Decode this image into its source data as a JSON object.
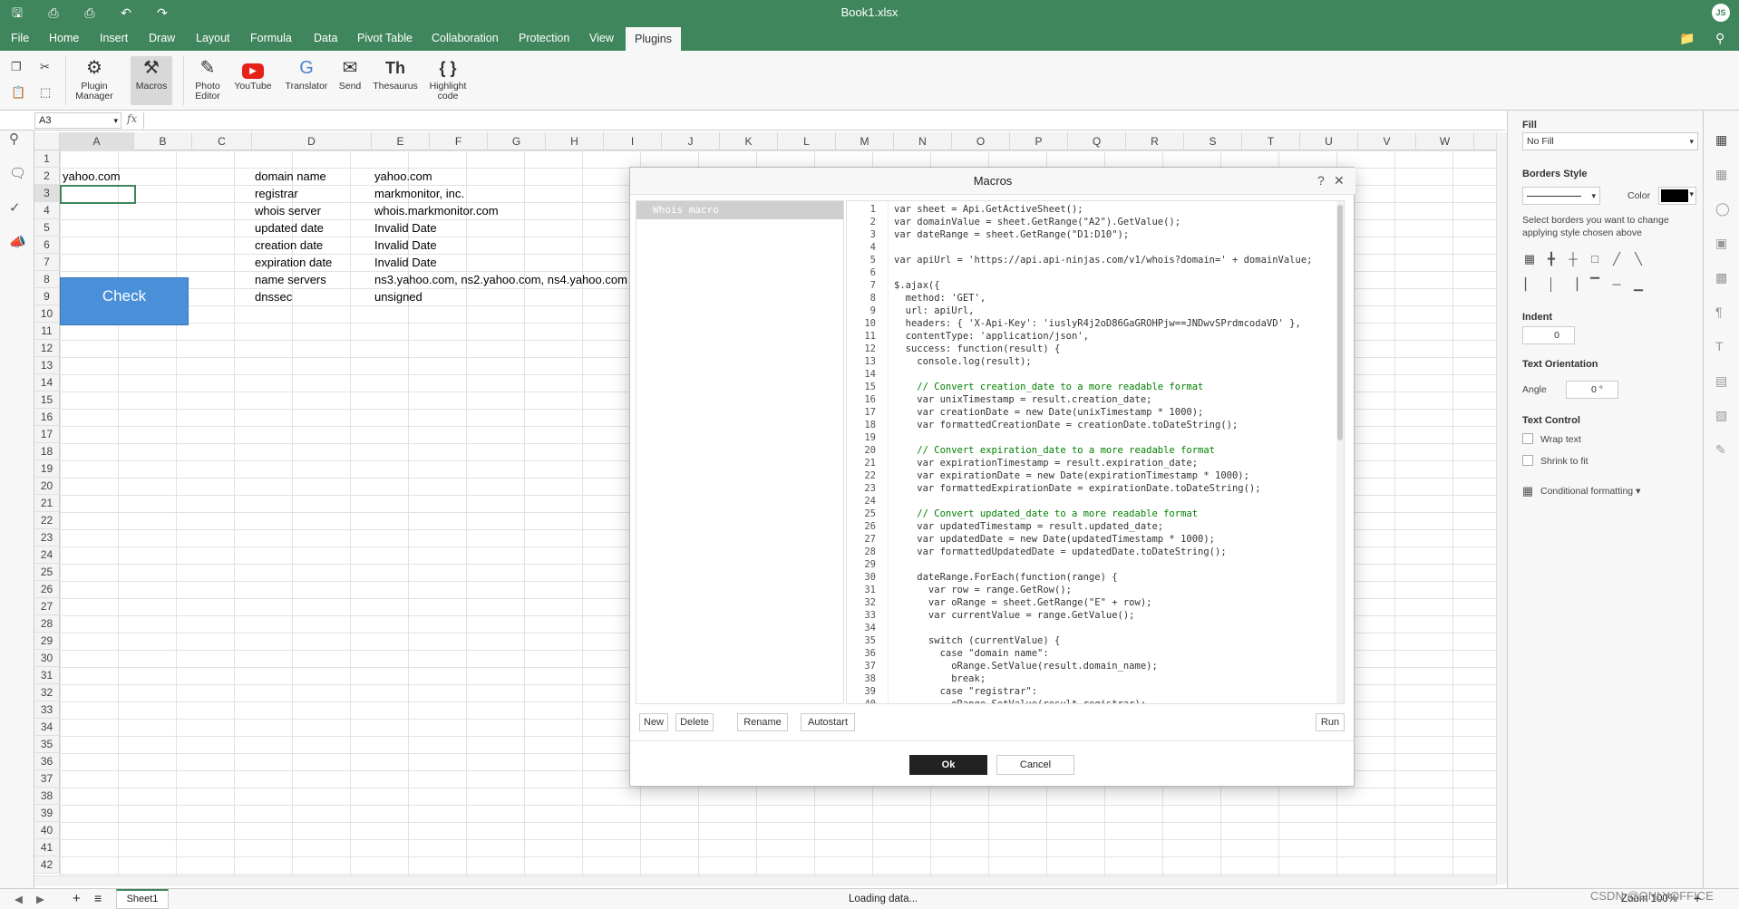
{
  "titlebar": {
    "file_name": "Book1.xlsx",
    "avatar": "JS"
  },
  "menu": {
    "tabs": [
      "File",
      "Home",
      "Insert",
      "Draw",
      "Layout",
      "Formula",
      "Data",
      "Pivot Table",
      "Collaboration",
      "Protection",
      "View",
      "Plugins"
    ],
    "active": "Plugins"
  },
  "ribbon": {
    "plugin_manager": "Plugin Manager",
    "macros": "Macros",
    "photo_editor": "Photo Editor",
    "youtube": "YouTube",
    "translator": "Translator",
    "send": "Send",
    "thesaurus": "Thesaurus",
    "thesaurus_icon": "Th",
    "highlight_code": "Highlight code",
    "highlight_icon": "{ }"
  },
  "formula_bar": {
    "cell_ref": "A3",
    "fx": "fx",
    "value": ""
  },
  "columns": [
    "A",
    "B",
    "C",
    "D",
    "E",
    "F",
    "G",
    "H",
    "I",
    "J",
    "K",
    "L",
    "M",
    "N",
    "O",
    "P",
    "Q",
    "R",
    "S",
    "T",
    "U",
    "V",
    "W"
  ],
  "rows": [
    "1",
    "2",
    "3",
    "4",
    "5",
    "6",
    "7",
    "8",
    "9",
    "10",
    "11",
    "12",
    "13",
    "14",
    "15",
    "16",
    "17",
    "18",
    "19",
    "20",
    "21",
    "22",
    "23",
    "24",
    "25",
    "26",
    "27",
    "28",
    "29",
    "30",
    "31",
    "32",
    "33",
    "34",
    "35",
    "36",
    "37",
    "38",
    "39",
    "40",
    "41",
    "42"
  ],
  "cells": {
    "a2": "yahoo.com",
    "labels": [
      "domain name",
      "registrar",
      "whois server",
      "updated date",
      "creation date",
      "expiration date",
      "name servers",
      "dnssec"
    ],
    "values": [
      "yahoo.com",
      "markmonitor, inc.",
      "whois.markmonitor.com",
      "Invalid Date",
      "Invalid Date",
      "Invalid Date",
      "ns3.yahoo.com, ns2.yahoo.com, ns4.yahoo.com",
      "unsigned"
    ]
  },
  "check_button": "Check",
  "status": {
    "sheet": "Sheet1",
    "loading": "Loading data...",
    "zoom": "Zoom 100%",
    "watermark": "CSDN @ONLYOFFICE"
  },
  "right_panel": {
    "fill": "Fill",
    "fill_value": "No Fill",
    "borders_style": "Borders Style",
    "color": "Color",
    "borders_hint": "Select borders you want to change applying style chosen above",
    "indent": "Indent",
    "indent_value": "0",
    "text_orientation": "Text Orientation",
    "angle": "Angle",
    "angle_value": "0 °",
    "text_control": "Text Control",
    "wrap_text": "Wrap text",
    "shrink_to_fit": "Shrink to fit",
    "conditional_formatting": "Conditional formatting"
  },
  "dialog": {
    "title": "Macros",
    "help": "?",
    "close": "✕",
    "macro_item": "Whois macro",
    "buttons": {
      "new": "New",
      "delete": "Delete",
      "rename": "Rename",
      "autostart": "Autostart",
      "run": "Run",
      "ok": "Ok",
      "cancel": "Cancel"
    },
    "code_lines": [
      "var sheet = Api.GetActiveSheet();",
      "var domainValue = sheet.GetRange(\"A2\").GetValue();",
      "var dateRange = sheet.GetRange(\"D1:D10\");",
      "",
      "var apiUrl = 'https://api.api-ninjas.com/v1/whois?domain=' + domainValue;",
      "",
      "$.ajax({",
      "  method: 'GET',",
      "  url: apiUrl,",
      "  headers: { 'X-Api-Key': 'iuslyR4j2oD86GaGROHPjw==JNDwvSPrdmcodaVD' },",
      "  contentType: 'application/json',",
      "  success: function(result) {",
      "    console.log(result);",
      "",
      "    // Convert creation_date to a more readable format",
      "    var unixTimestamp = result.creation_date;",
      "    var creationDate = new Date(unixTimestamp * 1000);",
      "    var formattedCreationDate = creationDate.toDateString();",
      "",
      "    // Convert expiration_date to a more readable format",
      "    var expirationTimestamp = result.expiration_date;",
      "    var expirationDate = new Date(expirationTimestamp * 1000);",
      "    var formattedExpirationDate = expirationDate.toDateString();",
      "",
      "    // Convert updated_date to a more readable format",
      "    var updatedTimestamp = result.updated_date;",
      "    var updatedDate = new Date(updatedTimestamp * 1000);",
      "    var formattedUpdatedDate = updatedDate.toDateString();",
      "",
      "    dateRange.ForEach(function(range) {",
      "      var row = range.GetRow();",
      "      var oRange = sheet.GetRange(\"E\" + row);",
      "      var currentValue = range.GetValue();",
      "",
      "      switch (currentValue) {",
      "        case \"domain name\":",
      "          oRange.SetValue(result.domain_name);",
      "          break;",
      "        case \"registrar\":",
      "          oRange.SetValue(result.registrar);"
    ]
  },
  "colors": {
    "accent": "#40865c",
    "check_button": "#4a90d9"
  }
}
